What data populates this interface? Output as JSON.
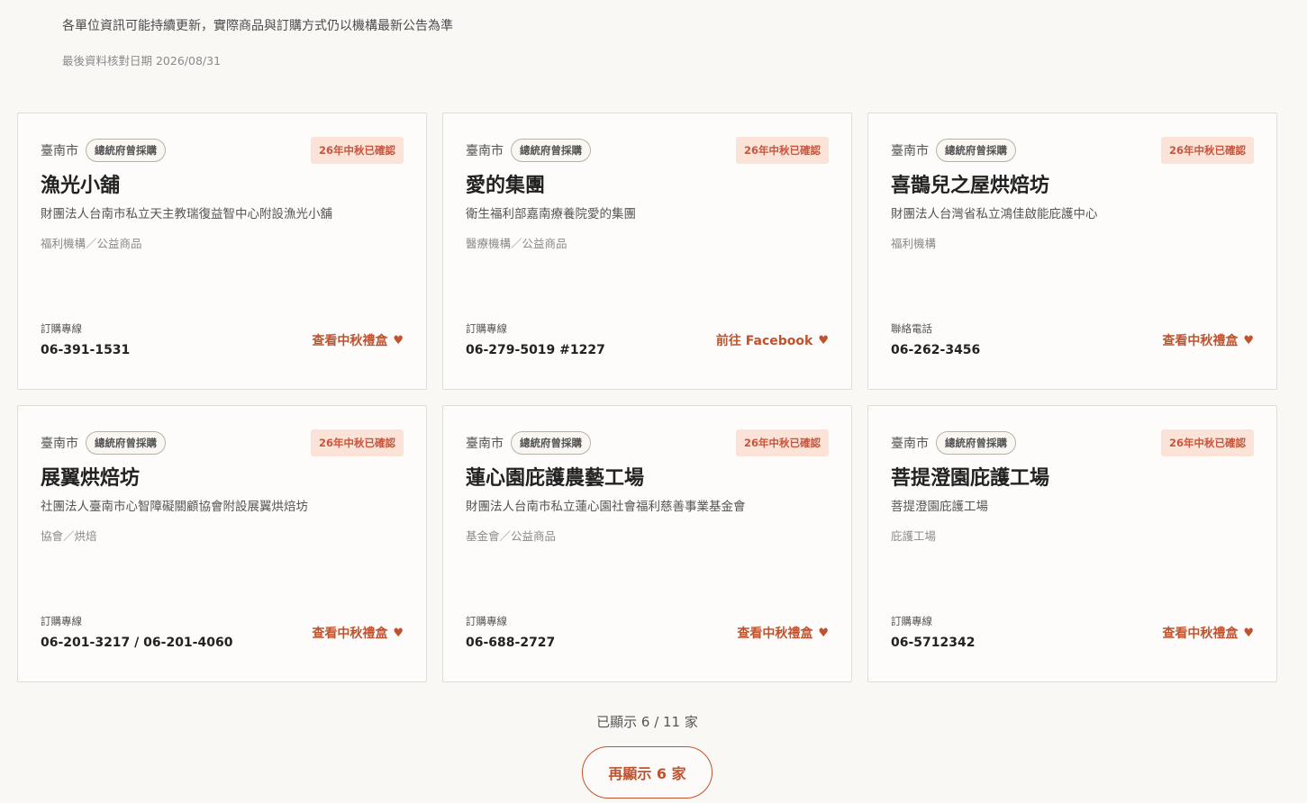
{
  "intro": {
    "note": "各單位資訊可能持續更新，實際商品與訂購方式仍以機構最新公告為準",
    "date": "最後資料核對日期 2026/08/31"
  },
  "colors": {
    "accent": "#c0532f",
    "confirm_bg": "#fbe3d8",
    "page_bg": "#faf8f5"
  },
  "cards": [
    {
      "city": "臺南市",
      "tag": "總統府曾採購",
      "status": "26年中秋已確認",
      "name": "漁光小舖",
      "org": "財團法人台南市私立天主教瑞復益智中心附設漁光小舖",
      "category": "福利機構／公益商品",
      "phone_label": "訂購專線",
      "phone": "06-391-1531",
      "link": "查看中秋禮盒",
      "link_icon": "heart-icon"
    },
    {
      "city": "臺南市",
      "tag": "總統府曾採購",
      "status": "26年中秋已確認",
      "name": "愛的集團",
      "org": "衛生福利部嘉南療養院愛的集團",
      "category": "醫療機構／公益商品",
      "phone_label": "訂購專線",
      "phone": "06-279-5019 #1227",
      "link": "前往 Facebook",
      "link_icon": "heart-icon"
    },
    {
      "city": "臺南市",
      "tag": "總統府曾採購",
      "status": "26年中秋已確認",
      "name": "喜鵲兒之屋烘焙坊",
      "org": "財團法人台灣省私立鴻佳啟能庇護中心",
      "category": "福利機構",
      "phone_label": "聯絡電話",
      "phone": "06-262-3456",
      "link": "查看中秋禮盒",
      "link_icon": "heart-icon"
    },
    {
      "city": "臺南市",
      "tag": "總統府曾採購",
      "status": "26年中秋已確認",
      "name": "展翼烘焙坊",
      "org": "社團法人臺南市心智障礙關顧協會附設展翼烘焙坊",
      "category": "協會／烘焙",
      "phone_label": "訂購專線",
      "phone": "06-201-3217 / 06-201-4060",
      "link": "查看中秋禮盒",
      "link_icon": "heart-icon"
    },
    {
      "city": "臺南市",
      "tag": "總統府曾採購",
      "status": "26年中秋已確認",
      "name": "蓮心園庇護農藝工場",
      "org": "財團法人台南市私立蓮心園社會福利慈善事業基金會",
      "category": "基金會／公益商品",
      "phone_label": "訂購專線",
      "phone": "06-688-2727",
      "link": "查看中秋禮盒",
      "link_icon": "heart-icon"
    },
    {
      "city": "臺南市",
      "tag": "總統府曾採購",
      "status": "26年中秋已確認",
      "name": "菩提澄園庇護工場",
      "org": "菩提澄園庇護工場",
      "category": "庇護工場",
      "phone_label": "訂購專線",
      "phone": "06-5712342",
      "link": "查看中秋禮盒",
      "link_icon": "heart-icon"
    }
  ],
  "pagination": {
    "shown_text": "已顯示 6 / 11 家",
    "more_button": "再顯示 6 家"
  }
}
